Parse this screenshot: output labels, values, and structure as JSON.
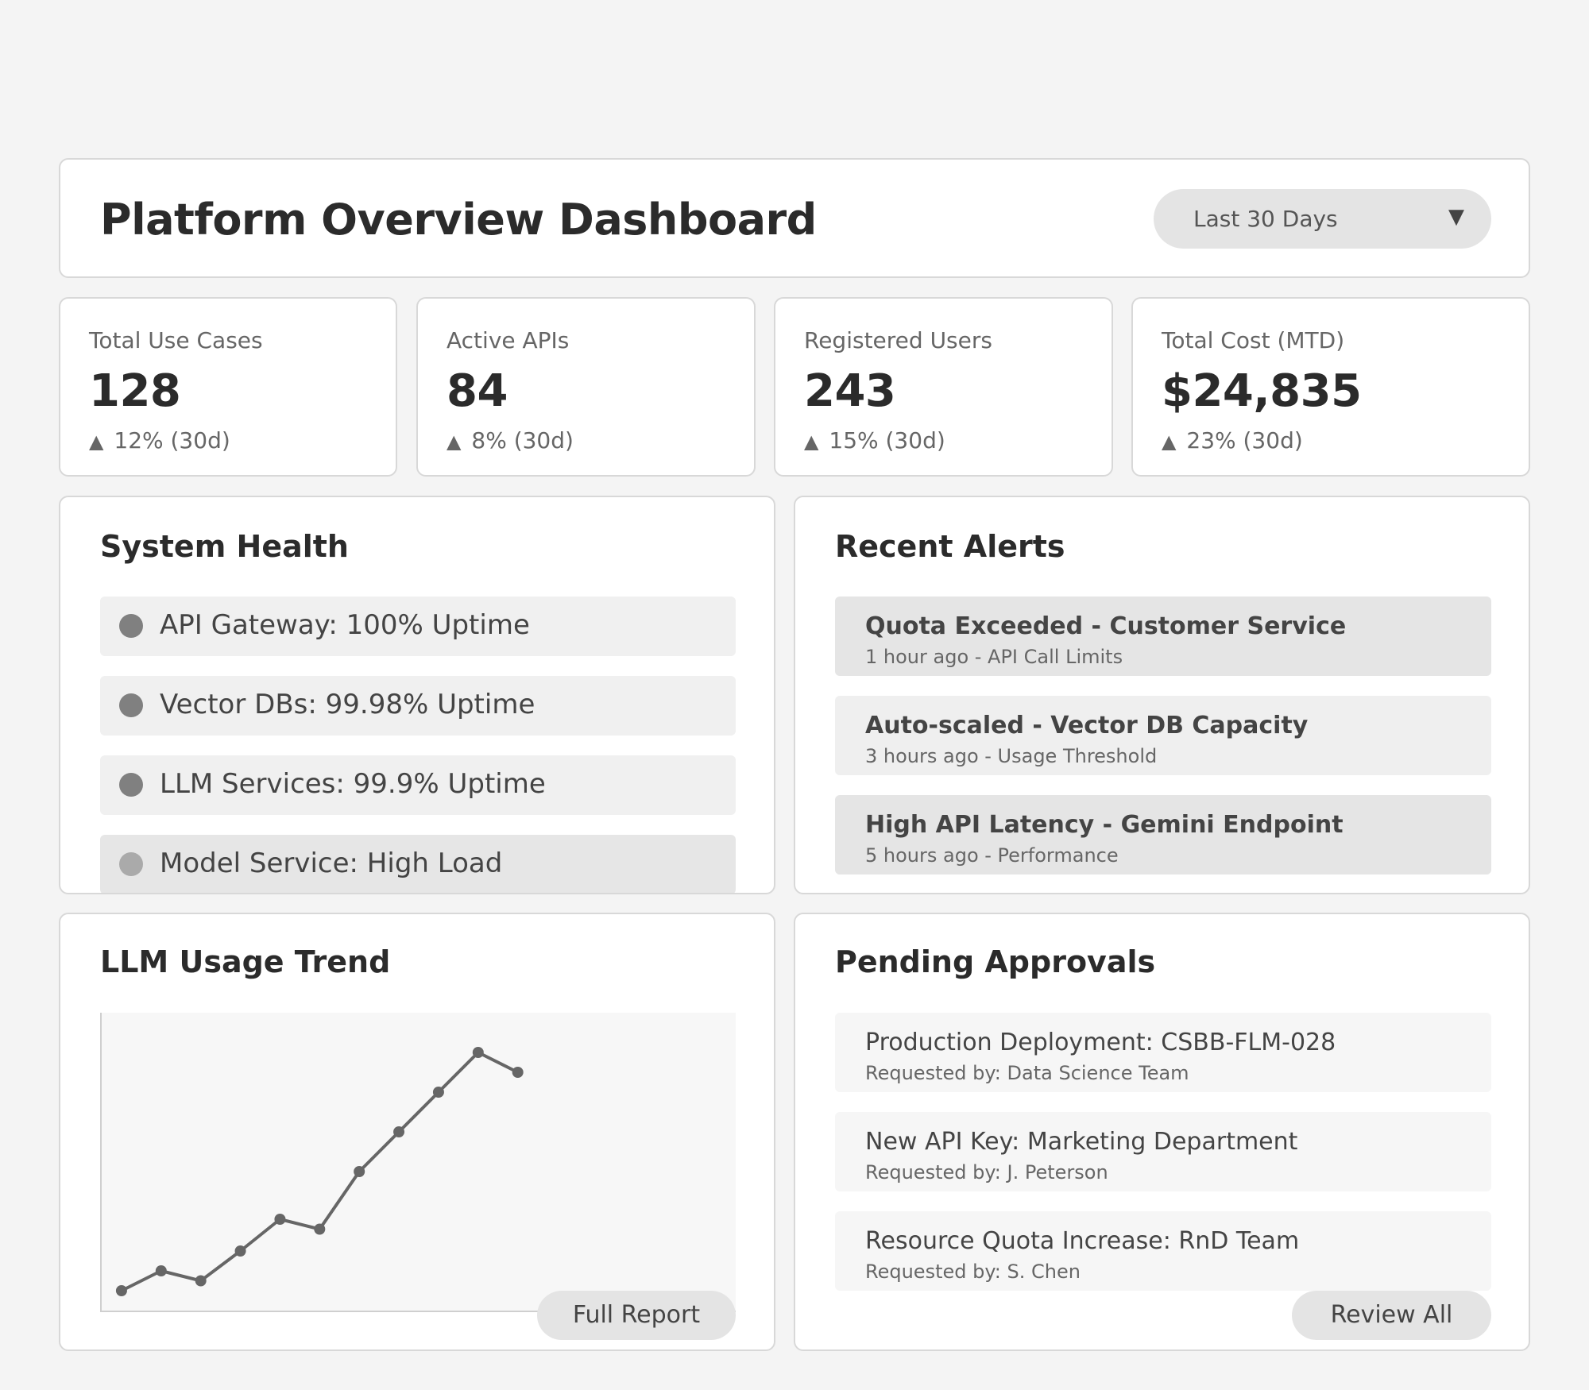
{
  "header": {
    "title": "Platform Overview Dashboard",
    "range_label": "Last 30 Days",
    "range_caret": "▼"
  },
  "kpis": [
    {
      "label": "Total Use Cases",
      "value": "128",
      "delta": "12% (30d)"
    },
    {
      "label": "Active APIs",
      "value": "84",
      "delta": "8% (30d)"
    },
    {
      "label": "Registered Users",
      "value": "243",
      "delta": "15% (30d)"
    },
    {
      "label": "Total Cost (MTD)",
      "value": "$24,835",
      "delta": "23% (30d)"
    }
  ],
  "delta_icon": "▲",
  "system_health": {
    "title": "System Health",
    "items": [
      {
        "text": "API Gateway: 100% Uptime",
        "status": "ok"
      },
      {
        "text": "Vector DBs: 99.98% Uptime",
        "status": "ok"
      },
      {
        "text": "LLM Services: 99.9% Uptime",
        "status": "ok"
      },
      {
        "text": "Model Service: High Load",
        "status": "warn"
      }
    ]
  },
  "recent_alerts": {
    "title": "Recent Alerts",
    "items": [
      {
        "title": "Quota Exceeded - Customer Service",
        "meta": "1 hour ago - API Call Limits"
      },
      {
        "title": "Auto-scaled - Vector DB Capacity",
        "meta": "3 hours ago - Usage Threshold"
      },
      {
        "title": "High API Latency - Gemini Endpoint",
        "meta": "5 hours ago - Performance"
      }
    ]
  },
  "usage_trend": {
    "title": "LLM Usage Trend",
    "button_label": "Full Report"
  },
  "chart_data": {
    "type": "line",
    "title": "LLM Usage Trend",
    "xlabel": "",
    "ylabel": "",
    "x": [
      1,
      2,
      3,
      4,
      5,
      6,
      7,
      8,
      9,
      10,
      11
    ],
    "series": [
      {
        "values": [
          5,
          10,
          7.5,
          15,
          23,
          20.5,
          35,
          45,
          55,
          65,
          60
        ]
      }
    ],
    "xlim": [
      0.5,
      16.5
    ],
    "ylim": [
      0,
      75
    ],
    "grid": false,
    "legend": "none",
    "line_color": "#666666"
  },
  "pending_approvals": {
    "title": "Pending Approvals",
    "items": [
      {
        "title": "Production Deployment: CSBB-FLM-028",
        "meta": "Requested by: Data Science Team"
      },
      {
        "title": "New API Key: Marketing Department",
        "meta": "Requested by: J. Peterson"
      },
      {
        "title": "Resource Quota Increase: RnD Team",
        "meta": "Requested by: S. Chen"
      }
    ],
    "button_label": "Review All"
  },
  "colors": {
    "background": "#f4f4f4",
    "card": "#ffffff",
    "status_ok": "#808080",
    "status_warn": "#aaaaaa"
  }
}
